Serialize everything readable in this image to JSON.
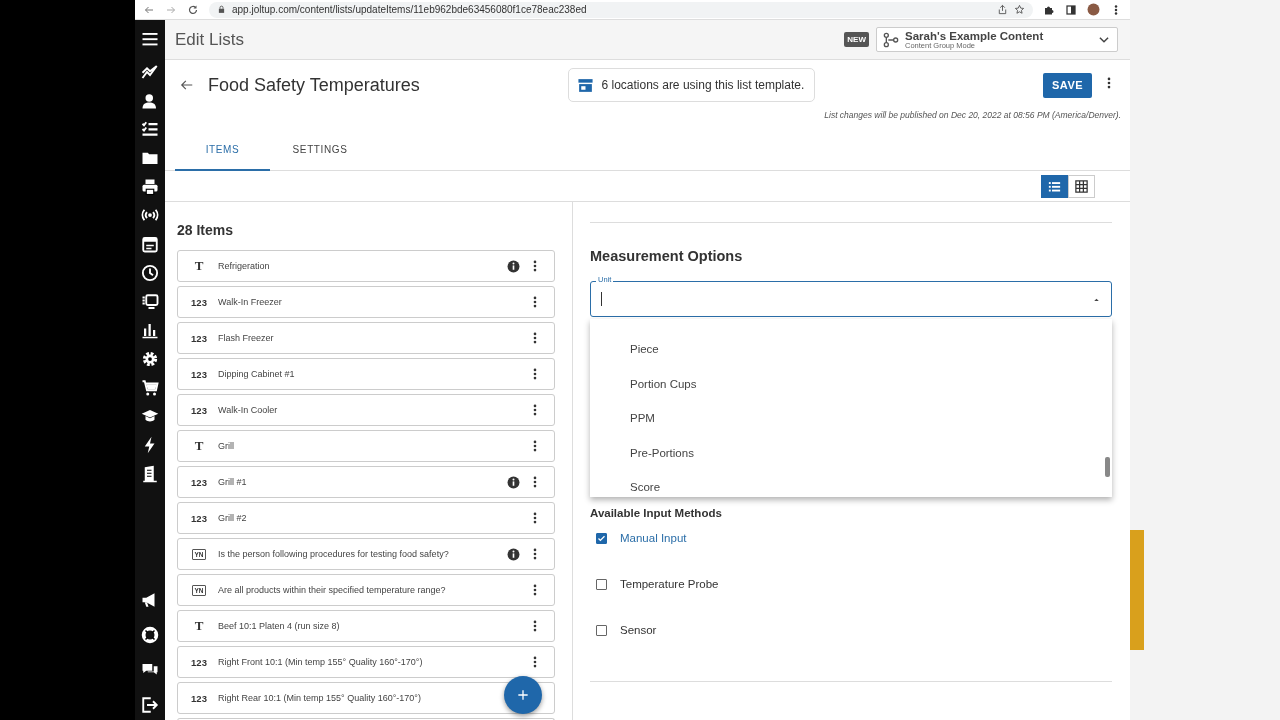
{
  "browser": {
    "url": "app.joltup.com/content/lists/updateItems/11eb962bde63456080f1ce78eac238ed"
  },
  "app_bar": {
    "title": "Edit Lists",
    "badge": "NEW",
    "content_group": {
      "name": "Sarah's Example Content",
      "mode": "Content Group Mode"
    }
  },
  "header": {
    "title": "Food Safety Temperatures",
    "banner": "6 locations are using this list template.",
    "save": "SAVE",
    "publish_note": "List changes will be published on Dec 20, 2022 at 08:56 PM (America/Denver)."
  },
  "tabs": [
    {
      "label": "ITEMS",
      "selected": true
    },
    {
      "label": "SETTINGS",
      "selected": false
    }
  ],
  "view_toggle": [
    {
      "kind": "list",
      "selected": true
    },
    {
      "kind": "grid",
      "selected": false
    }
  ],
  "items_panel": {
    "count": "28 Items",
    "items": [
      {
        "kind": "text",
        "mark": "T",
        "label": "Refrigeration",
        "info": true,
        "menu": true
      },
      {
        "kind": "number",
        "mark": "123",
        "label": "Walk-In Freezer",
        "info": false,
        "menu": true
      },
      {
        "kind": "number",
        "mark": "123",
        "label": "Flash Freezer",
        "info": false,
        "menu": true
      },
      {
        "kind": "number",
        "mark": "123",
        "label": "Dipping Cabinet #1",
        "info": false,
        "menu": true
      },
      {
        "kind": "number",
        "mark": "123",
        "label": "Walk-In Cooler",
        "info": false,
        "menu": true
      },
      {
        "kind": "text",
        "mark": "T",
        "label": "Grill",
        "info": false,
        "menu": true
      },
      {
        "kind": "number",
        "mark": "123",
        "label": "Grill #1",
        "info": true,
        "menu": true
      },
      {
        "kind": "number",
        "mark": "123",
        "label": "Grill #2",
        "info": false,
        "menu": true
      },
      {
        "kind": "yes_no",
        "mark": "YN",
        "label": "Is the person following procedures for testing food safety?",
        "info": true,
        "menu": true
      },
      {
        "kind": "yes_no",
        "mark": "YN",
        "label": "Are all products within their specified temperature range?",
        "info": false,
        "menu": true
      },
      {
        "kind": "text",
        "mark": "T",
        "label": "Beef 10:1 Platen 4 (run size 8)",
        "info": false,
        "menu": true
      },
      {
        "kind": "number",
        "mark": "123",
        "label": "Right Front 10:1 (Min temp 155° Quality 160°-170°)",
        "info": false,
        "menu": true
      },
      {
        "kind": "number",
        "mark": "123",
        "label": "Right Rear 10:1 (Min temp 155° Quality 160°-170°)",
        "info": false,
        "menu": false
      }
    ]
  },
  "measurement": {
    "title": "Measurement Options",
    "unit_field": {
      "label": "Unit",
      "expanded": true,
      "options": [
        "Piece",
        "Portion Cups",
        "PPM",
        "Pre-Portions",
        "Score"
      ]
    },
    "input_methods": {
      "title": "Available Input Methods",
      "methods": [
        {
          "label": "Manual Input",
          "checked": true
        },
        {
          "label": "Temperature Probe",
          "checked": false
        },
        {
          "label": "Sensor",
          "checked": false
        }
      ]
    }
  }
}
